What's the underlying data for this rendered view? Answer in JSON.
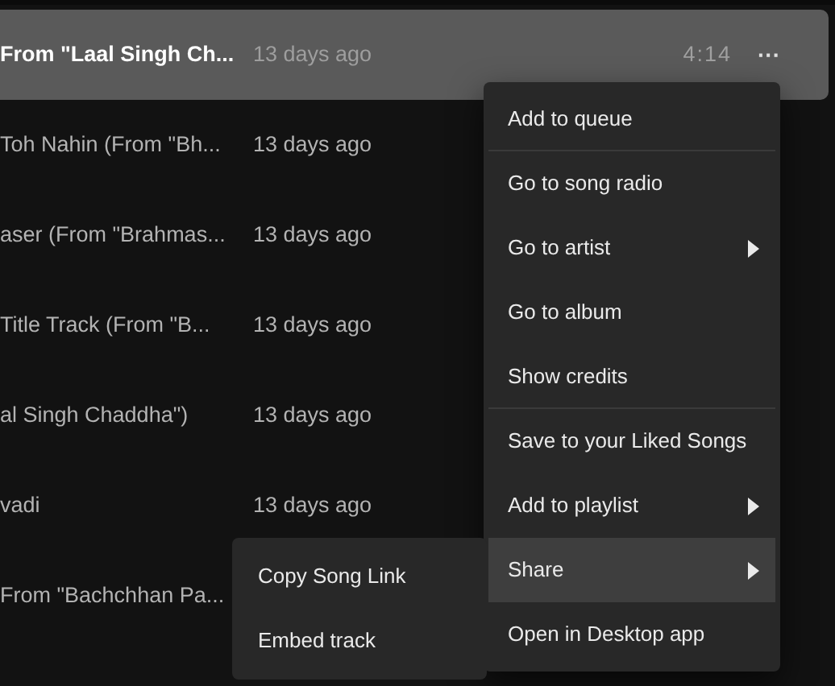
{
  "tracks": [
    {
      "title": "From \"Laal Singh Ch...",
      "added": "13 days ago",
      "duration": "4:14",
      "more": "···",
      "selected": true
    },
    {
      "title": "Toh Nahin (From \"Bh...",
      "added": "13 days ago",
      "selected": false
    },
    {
      "title": "aser (From \"Brahmas...",
      "added": "13 days ago",
      "selected": false
    },
    {
      "title": "Title Track (From \"B...",
      "added": "13 days ago",
      "selected": false
    },
    {
      "title": "al Singh Chaddha\")",
      "added": "13 days ago",
      "selected": false
    },
    {
      "title": "vadi",
      "added": "13 days ago",
      "selected": false
    },
    {
      "title": "From \"Bachchhan Pa...",
      "selected": false
    }
  ],
  "context_menu": {
    "items": [
      {
        "label": "Add to queue",
        "submenu": false,
        "separator_after": true,
        "selected": false
      },
      {
        "label": "Go to song radio",
        "submenu": false,
        "separator_after": false,
        "selected": false
      },
      {
        "label": "Go to artist",
        "submenu": true,
        "separator_after": false,
        "selected": false
      },
      {
        "label": "Go to album",
        "submenu": false,
        "separator_after": false,
        "selected": false
      },
      {
        "label": "Show credits",
        "submenu": false,
        "separator_after": true,
        "selected": false
      },
      {
        "label": "Save to your Liked Songs",
        "submenu": false,
        "separator_after": false,
        "selected": false
      },
      {
        "label": "Add to playlist",
        "submenu": true,
        "separator_after": false,
        "selected": false
      },
      {
        "label": "Share",
        "submenu": true,
        "separator_after": false,
        "selected": true
      },
      {
        "label": "Open in Desktop app",
        "submenu": false,
        "separator_after": false,
        "selected": false
      }
    ]
  },
  "share_submenu": {
    "items": [
      {
        "label": "Copy Song Link"
      },
      {
        "label": "Embed track"
      }
    ]
  }
}
